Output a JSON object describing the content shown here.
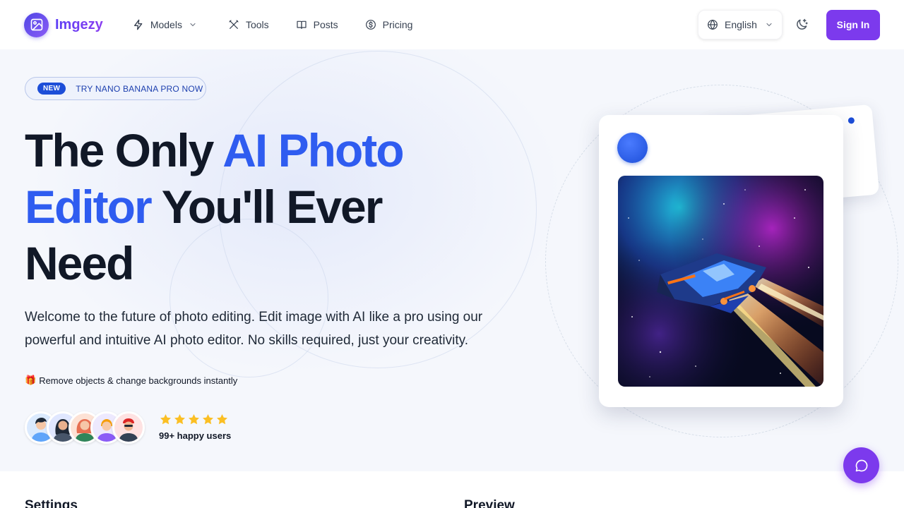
{
  "header": {
    "logo_text": "Imgezy",
    "nav": [
      {
        "label": "Models",
        "icon": "bolt-icon",
        "has_dropdown": true
      },
      {
        "label": "Tools",
        "icon": "tools-icon"
      },
      {
        "label": "Posts",
        "icon": "book-icon"
      },
      {
        "label": "Pricing",
        "icon": "dollar-circle-icon"
      }
    ],
    "language": "English",
    "signin_label": "Sign In"
  },
  "hero": {
    "badge_new": "NEW",
    "badge_text": "TRY NANO BANANA PRO NOW",
    "headline_part1": "The Only ",
    "headline_blue1": "AI Photo",
    "headline_blue2": "Editor",
    "headline_part2": " You'll Ever",
    "headline_part3": "Need",
    "subtext_line1": "Welcome to the future of photo editing. Edit image with AI like a pro using our",
    "subtext_line2": "powerful and intuitive AI photo editor. No skills required, just your creativity.",
    "feature_icon": "🎁",
    "feature_text": "Remove objects & change backgrounds instantly",
    "rating_stars": 5,
    "users_text": "99+ happy users"
  },
  "sections": {
    "settings_title": "Settings",
    "preview_title": "Preview"
  },
  "colors": {
    "brand_purple": "#7c3aed",
    "headline_blue": "#2f5cf0",
    "star_yellow": "#fbbf24"
  }
}
